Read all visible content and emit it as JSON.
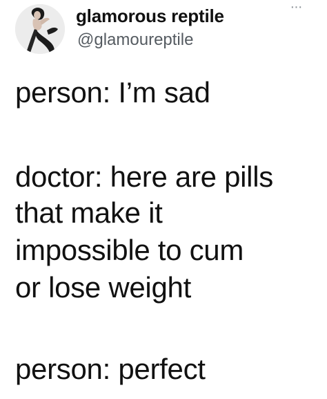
{
  "tweet": {
    "display_name": "glamorous reptile",
    "handle": "@glamoureptile",
    "more_label": "···",
    "avatar_icon": "profile-photo",
    "lines": [
      "person: I’m sad",
      "doctor: here are pills",
      "that make it",
      "impossible to cum",
      "or lose weight",
      "person: perfect"
    ]
  },
  "colors": {
    "text": "#111111",
    "handle": "#555b61",
    "background": "#ffffff"
  }
}
